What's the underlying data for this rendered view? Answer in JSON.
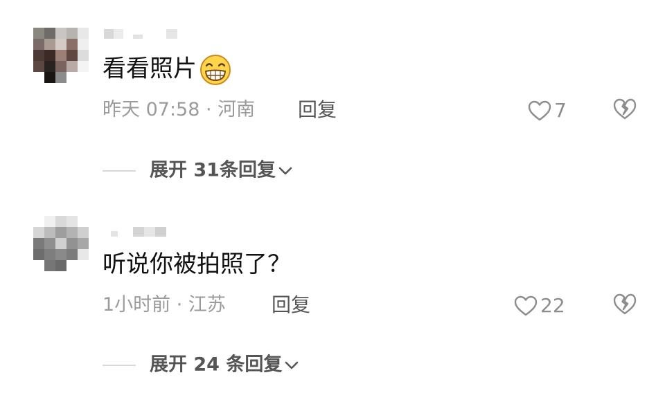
{
  "comments": [
    {
      "text": "看看照片",
      "emoji": "grinning-face-emoji",
      "meta": "昨天 07:58 · 河南",
      "reply_label": "回复",
      "likes": "7",
      "expand_label": "展开 31条回复"
    },
    {
      "text": "听说你被拍照了？",
      "meta": "1小时前 · 江苏",
      "reply_label": "回复",
      "likes": "22",
      "expand_label": "展开 24 条回复"
    }
  ],
  "colors": {
    "text": "#111111",
    "meta": "#9b9b9b",
    "action": "#555555",
    "icon": "#8c8c8c",
    "divider": "#d8d8d8"
  }
}
